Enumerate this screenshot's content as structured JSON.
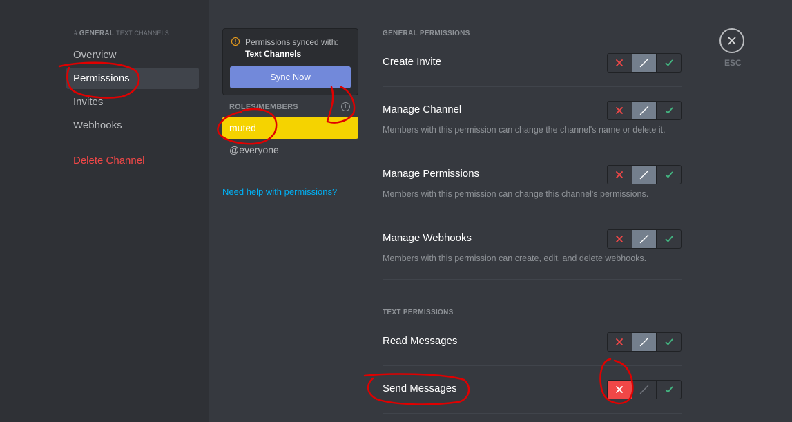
{
  "sidebar": {
    "channel_hash": "#",
    "channel_name": "GENERAL",
    "channel_category": "TEXT CHANNELS",
    "items": [
      {
        "label": "Overview"
      },
      {
        "label": "Permissions"
      },
      {
        "label": "Invites"
      },
      {
        "label": "Webhooks"
      }
    ],
    "delete_label": "Delete Channel"
  },
  "sync": {
    "icon": "warning-icon",
    "icon_glyph": "!",
    "line1": "Permissions synced with:",
    "line2": "Text Channels",
    "button": "Sync Now"
  },
  "roles": {
    "header": "ROLES/MEMBERS",
    "add_icon": "plus-circle-icon",
    "add_glyph": "+",
    "items": [
      "muted",
      "@everyone"
    ],
    "selected_color": "#f5d300",
    "help_link": "Need help with permissions?"
  },
  "permissions": {
    "general_header": "GENERAL PERMISSIONS",
    "text_header": "TEXT PERMISSIONS",
    "general": [
      {
        "title": "Create Invite",
        "desc": "",
        "state": "inherit"
      },
      {
        "title": "Manage Channel",
        "desc": "Members with this permission can change the channel's name or delete it.",
        "state": "inherit"
      },
      {
        "title": "Manage Permissions",
        "desc": "Members with this permission can change this channel's permissions.",
        "state": "inherit"
      },
      {
        "title": "Manage Webhooks",
        "desc": "Members with this permission can create, edit, and delete webhooks.",
        "state": "inherit"
      }
    ],
    "text": [
      {
        "title": "Read Messages",
        "desc": "",
        "state": "inherit"
      },
      {
        "title": "Send Messages",
        "desc": "",
        "state": "deny"
      }
    ]
  },
  "close": {
    "icon": "close-icon",
    "label": "ESC"
  },
  "colors": {
    "deny": "#f04747",
    "allow": "#43b581",
    "accent": "#7289da",
    "annotation": "#e00000"
  }
}
